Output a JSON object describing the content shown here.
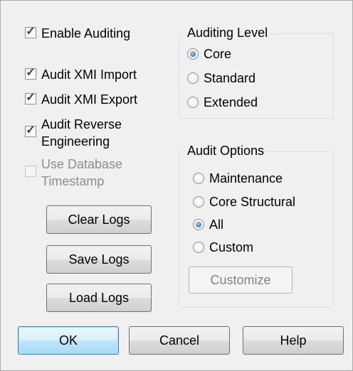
{
  "checkboxes": [
    {
      "label": "Enable Auditing",
      "checked": true,
      "enabled": true
    },
    {
      "label": "Audit XMI Import",
      "checked": true,
      "enabled": true
    },
    {
      "label": "Audit XMI Export",
      "checked": true,
      "enabled": true
    },
    {
      "label_line1": "Audit Reverse",
      "label_line2": "Engineering",
      "checked": true,
      "enabled": true
    },
    {
      "label_line1": "Use Database",
      "label_line2": "Timestamp",
      "checked": false,
      "enabled": false
    }
  ],
  "auditing_level": {
    "legend": "Auditing Level",
    "options": [
      "Core",
      "Standard",
      "Extended"
    ],
    "selected": "Core"
  },
  "audit_options": {
    "legend": "Audit Options",
    "options": [
      "Maintenance",
      "Core Structural",
      "All",
      "Custom"
    ],
    "selected": "All",
    "customize_label": "Customize"
  },
  "log_buttons": {
    "clear": "Clear Logs",
    "save": "Save Logs",
    "load": "Load Logs"
  },
  "footer": {
    "ok": "OK",
    "cancel": "Cancel",
    "help": "Help"
  },
  "icons": {
    "checkmark": "check-icon",
    "radio_dot": "radio-selected-icon"
  },
  "colors": {
    "dialog_bg": "#f0f0f0",
    "default_button_border": "#3c7fb1",
    "disabled_text": "#8d8d8d"
  }
}
